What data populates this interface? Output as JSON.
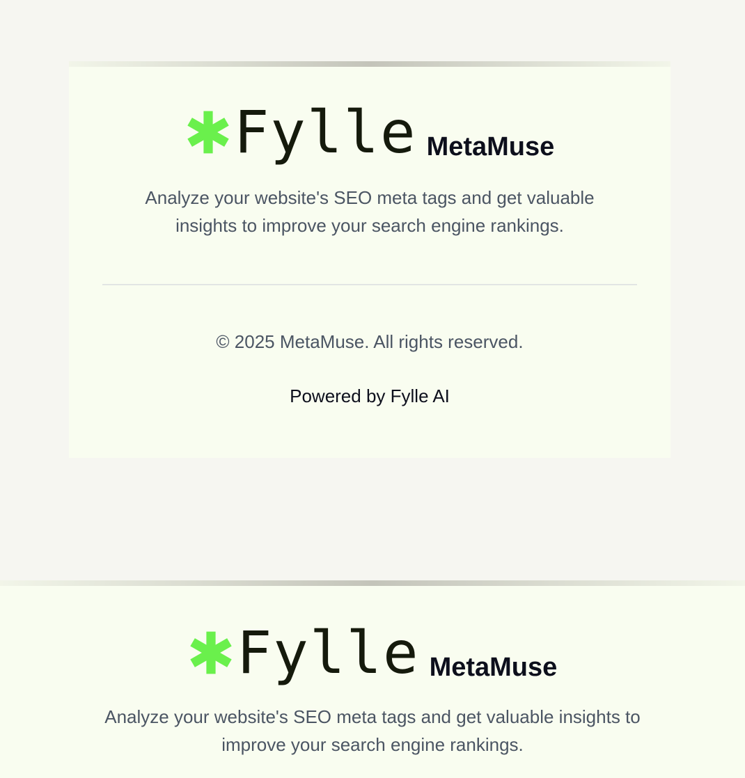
{
  "brand": {
    "logo_text": "Fylle",
    "logo_icon": "asterisk-icon",
    "app_name": "MetaMuse",
    "accent_color": "#6af04c"
  },
  "card": {
    "tagline_line1": "Analyze your website's SEO meta tags and get valuable",
    "tagline_line2": "insights to improve your search engine rankings.",
    "copyright": "© 2025 MetaMuse. All rights reserved.",
    "powered_by": "Powered by Fylle AI"
  },
  "band": {
    "tagline_line1": "Analyze your website's SEO meta tags and get valuable insights to",
    "tagline_line2": "improve your search engine rankings."
  }
}
